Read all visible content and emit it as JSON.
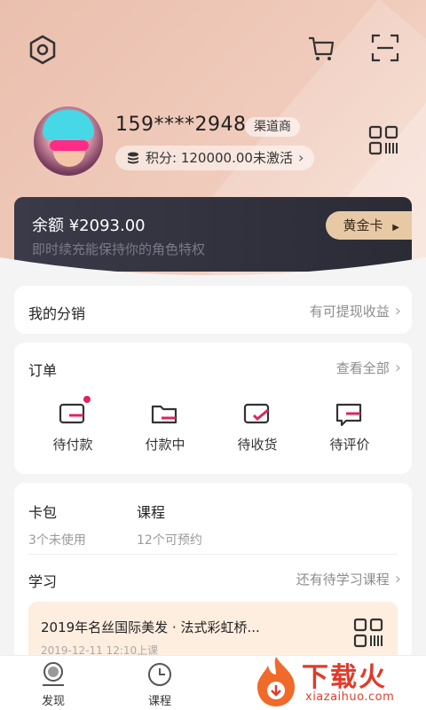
{
  "header": {
    "phone": "159****2948",
    "badge": "渠道商",
    "points": "积分: 120000.00未激活",
    "icons": [
      "settings-icon",
      "cart-icon",
      "scan-icon",
      "qr-code-icon"
    ]
  },
  "balance": {
    "amount": "余额 ¥2093.00",
    "desc": "即时续充能保持你的角色特权",
    "card_level": "黄金卡"
  },
  "distribution": {
    "title": "我的分销",
    "right": "有可提现收益"
  },
  "orders": {
    "title": "订单",
    "right": "查看全部",
    "items": [
      {
        "label": "待付款"
      },
      {
        "label": "付款中"
      },
      {
        "label": "待收货"
      },
      {
        "label": "待评价"
      }
    ]
  },
  "stats": {
    "wallet": {
      "title": "卡包",
      "sub": "3个未使用"
    },
    "course": {
      "title": "课程",
      "sub": "12个可预约"
    }
  },
  "study": {
    "title": "学习",
    "right": "还有待学习课程",
    "course_title": "2019年名丝国际美发 · 法式彩虹桥...",
    "course_date": "2019-12-11 12:10上课"
  },
  "tabbar": {
    "tabs": [
      {
        "label": "发现"
      },
      {
        "label": "课程"
      }
    ]
  },
  "watermark": {
    "text": "下载火",
    "url": "xiazaihuo.com"
  },
  "colors": {
    "accent": "#e0245e",
    "header_bg": "#eabfae",
    "card_dark": "#2f2f3b",
    "gold": "#e7c9a6"
  }
}
